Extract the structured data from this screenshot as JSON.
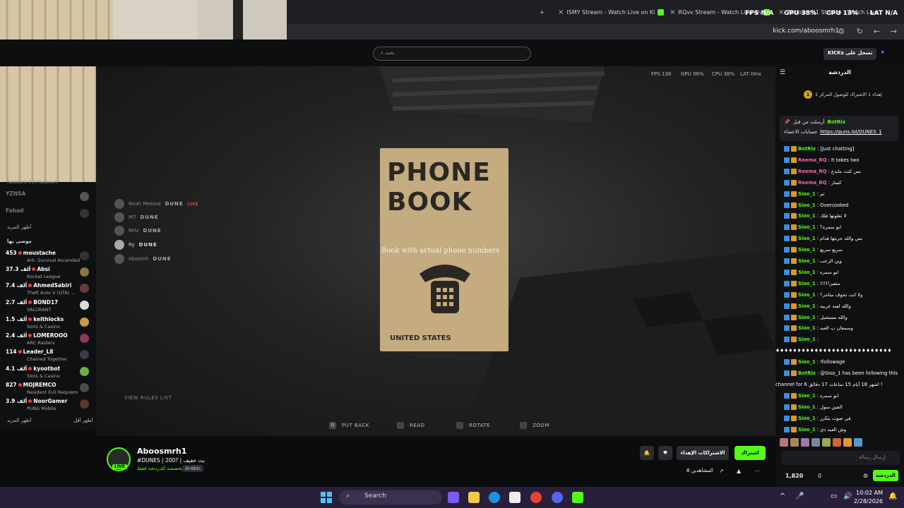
{
  "browser": {
    "tabs": [
      {
        "label": "ISMY Stream - Watch Live on Ki"
      },
      {
        "label": "RQvv Stream - Watch Live on"
      },
      {
        "label": "Aboosmrh1 Stream - Watch Live"
      }
    ],
    "url": "kick.com/aboosmrh1",
    "new_tab_label": "+"
  },
  "overlay_stats": {
    "fps_label": "FPS",
    "fps_value": "N/A",
    "gpu_label": "GPU",
    "gpu_value": "38%",
    "cpu_label": "CPU",
    "cpu_value": "13%",
    "lat_label": "LAT",
    "lat_value": "N/A"
  },
  "header": {
    "search_placeholder": "بحث",
    "login_label": "KICKs تسجل على"
  },
  "sidebar": {
    "partial_game": "Resident Evil Requiem",
    "offline": [
      "YZNSA",
      "Fahad"
    ],
    "show_more_1": "أظهر المزيد",
    "section_recommended": "موصى بها",
    "channels": [
      {
        "viewers": "453",
        "name": "moustache",
        "game": "Ark: Survival Ascended"
      },
      {
        "viewers": "37.3 ألف",
        "name": "Absi",
        "game": "Rocket League"
      },
      {
        "viewers": "7.4 ألف",
        "name": "AhmedSabiri",
        "game": "Theft Auto V (GTA) ..."
      },
      {
        "viewers": "2.7 ألف",
        "name": "BOND17",
        "game": "VALORANT"
      },
      {
        "viewers": "1.5 ألف",
        "name": "keithlocks",
        "game": "Slots & Casino"
      },
      {
        "viewers": "2.4 ألف",
        "name": "LOMEROOO",
        "game": "ARC Raiders"
      },
      {
        "viewers": "114",
        "name": "Leader_L8",
        "game": "Chained Together"
      },
      {
        "viewers": "4.1 ألف",
        "name": "kyootbot",
        "game": "Slots & Casino"
      },
      {
        "viewers": "827",
        "name": "MOJREMCO",
        "game": "Resident Evil Requiem"
      },
      {
        "viewers": "3.9 ألف",
        "name": "NoorGamer",
        "game": "PUBG Mobile"
      }
    ],
    "show_more_2": "أظهر المزيد",
    "show_less": "أظهر أقل"
  },
  "video": {
    "hud": {
      "fps": "FPS 138",
      "gpu": "GPU 96%",
      "cpu": "CPU 38%",
      "lat": "LAT 0ms"
    },
    "phonebook_title": "PHONE BOOK",
    "phonebook_footer": "UNITED STATES",
    "phonebook_caption": "Book with actual phone numbers",
    "dune_rows": [
      {
        "name": "Noah Meklad",
        "tag": "DUNE",
        "live": "LIVE"
      },
      {
        "name": "M7",
        "tag": "DUNE"
      },
      {
        "name": "Mrlz",
        "tag": "DUNE"
      },
      {
        "name": "Ry",
        "tag": "DUNE"
      },
      {
        "name": "Abosmh",
        "tag": "DUNE"
      }
    ],
    "rules_label": "VIEW RULES LIST",
    "prompts": [
      {
        "key": "Q",
        "label": "PUT BACK"
      },
      {
        "key": "",
        "label": "READ"
      },
      {
        "key": "",
        "label": "ROTATE"
      },
      {
        "key": "",
        "label": "ZOOM"
      }
    ]
  },
  "stream": {
    "name": "Aboosmrh1",
    "live_badge": "LIVE",
    "title": "#DUNES | 200? | بث خفيف",
    "category": "مخصصة للدردشة فقط",
    "language": "Arabic",
    "subscribe_label": "اشتراك",
    "gift_label": "الاشتراكات الإهداء",
    "viewers": "8 المشاهدين"
  },
  "chat": {
    "title": "الدردشة",
    "leaderboard": "إهداء 1 الاشتراك للوصول المركز 1",
    "pinned_by": "أرسلت من قبل",
    "pinned_user": "BotRix",
    "pinned_text": "حسابات الاعضاء",
    "pinned_link": "https://guns.lol/DUNES_1",
    "messages": [
      {
        "user": "BotRix",
        "text": "[Just chatting]",
        "bot": true
      },
      {
        "user": "Reema_RQ",
        "text": "It takes two",
        "pink": true
      },
      {
        "user": "Reema_RQ",
        "text": "بس كنت مايدع",
        "pink": true
      },
      {
        "user": "Reema_RQ",
        "text": "كسار",
        "pink": true
      },
      {
        "user": "Sioo_1",
        "text": "تم"
      },
      {
        "user": "Sioo_1",
        "text": "Overcooked"
      },
      {
        "user": "Sioo_1",
        "text": "لا تعلونها فلك"
      },
      {
        "user": "Sioo_1",
        "text": "ابو سمره؟"
      },
      {
        "user": "Sioo_1",
        "text": "بس والله جربتها قدام"
      },
      {
        "user": "Sioo_1",
        "text": "سريع سريع"
      },
      {
        "user": "Sioo_1",
        "text": "وين الرعب"
      },
      {
        "user": "Sioo_1",
        "text": "ابو سمره"
      },
      {
        "user": "Sioo_1",
        "text": "!!!!!متعبر"
      },
      {
        "user": "Sioo_1",
        "text": "ولا انت تخوف متاجر؟"
      },
      {
        "user": "Sioo_1",
        "text": "والله لعبه عربيه"
      },
      {
        "user": "Sioo_1",
        "text": "والله مستحيل"
      },
      {
        "user": "Sioo_1",
        "text": "وسمعان ب العبه"
      },
      {
        "user": "Sioo_1",
        "text": ""
      },
      {
        "user": "",
        "text": "♦♦♦♦♦♦♦♦♦♦♦♦♦♦♦♦♦♦♦♦♦♦♦♦♦♦♦♦♦♦"
      },
      {
        "user": "Sioo_1",
        "text": "!followage"
      },
      {
        "user": "BotRix",
        "text": "@Sioo_1 has been following this",
        "bot": true
      },
      {
        "user": "",
        "text": "channel for 6 اشهر 18 أيام 15 ساعات 17 دقائق !"
      },
      {
        "user": "Sioo_1",
        "text": "ابو سمره"
      },
      {
        "user": "Sioo_1",
        "text": "الجين سول"
      },
      {
        "user": "Sioo_1",
        "text": "في صوت يتكرر"
      },
      {
        "user": "Sioo_1",
        "text": "وش العبه ذي"
      }
    ],
    "input_placeholder": "إرسال رسالة",
    "points": "1,820",
    "zero": "0",
    "send_label": "الدردشة"
  },
  "taskbar": {
    "search_label": "Search",
    "time": "10:02 AM",
    "date": "2/28/2026"
  }
}
